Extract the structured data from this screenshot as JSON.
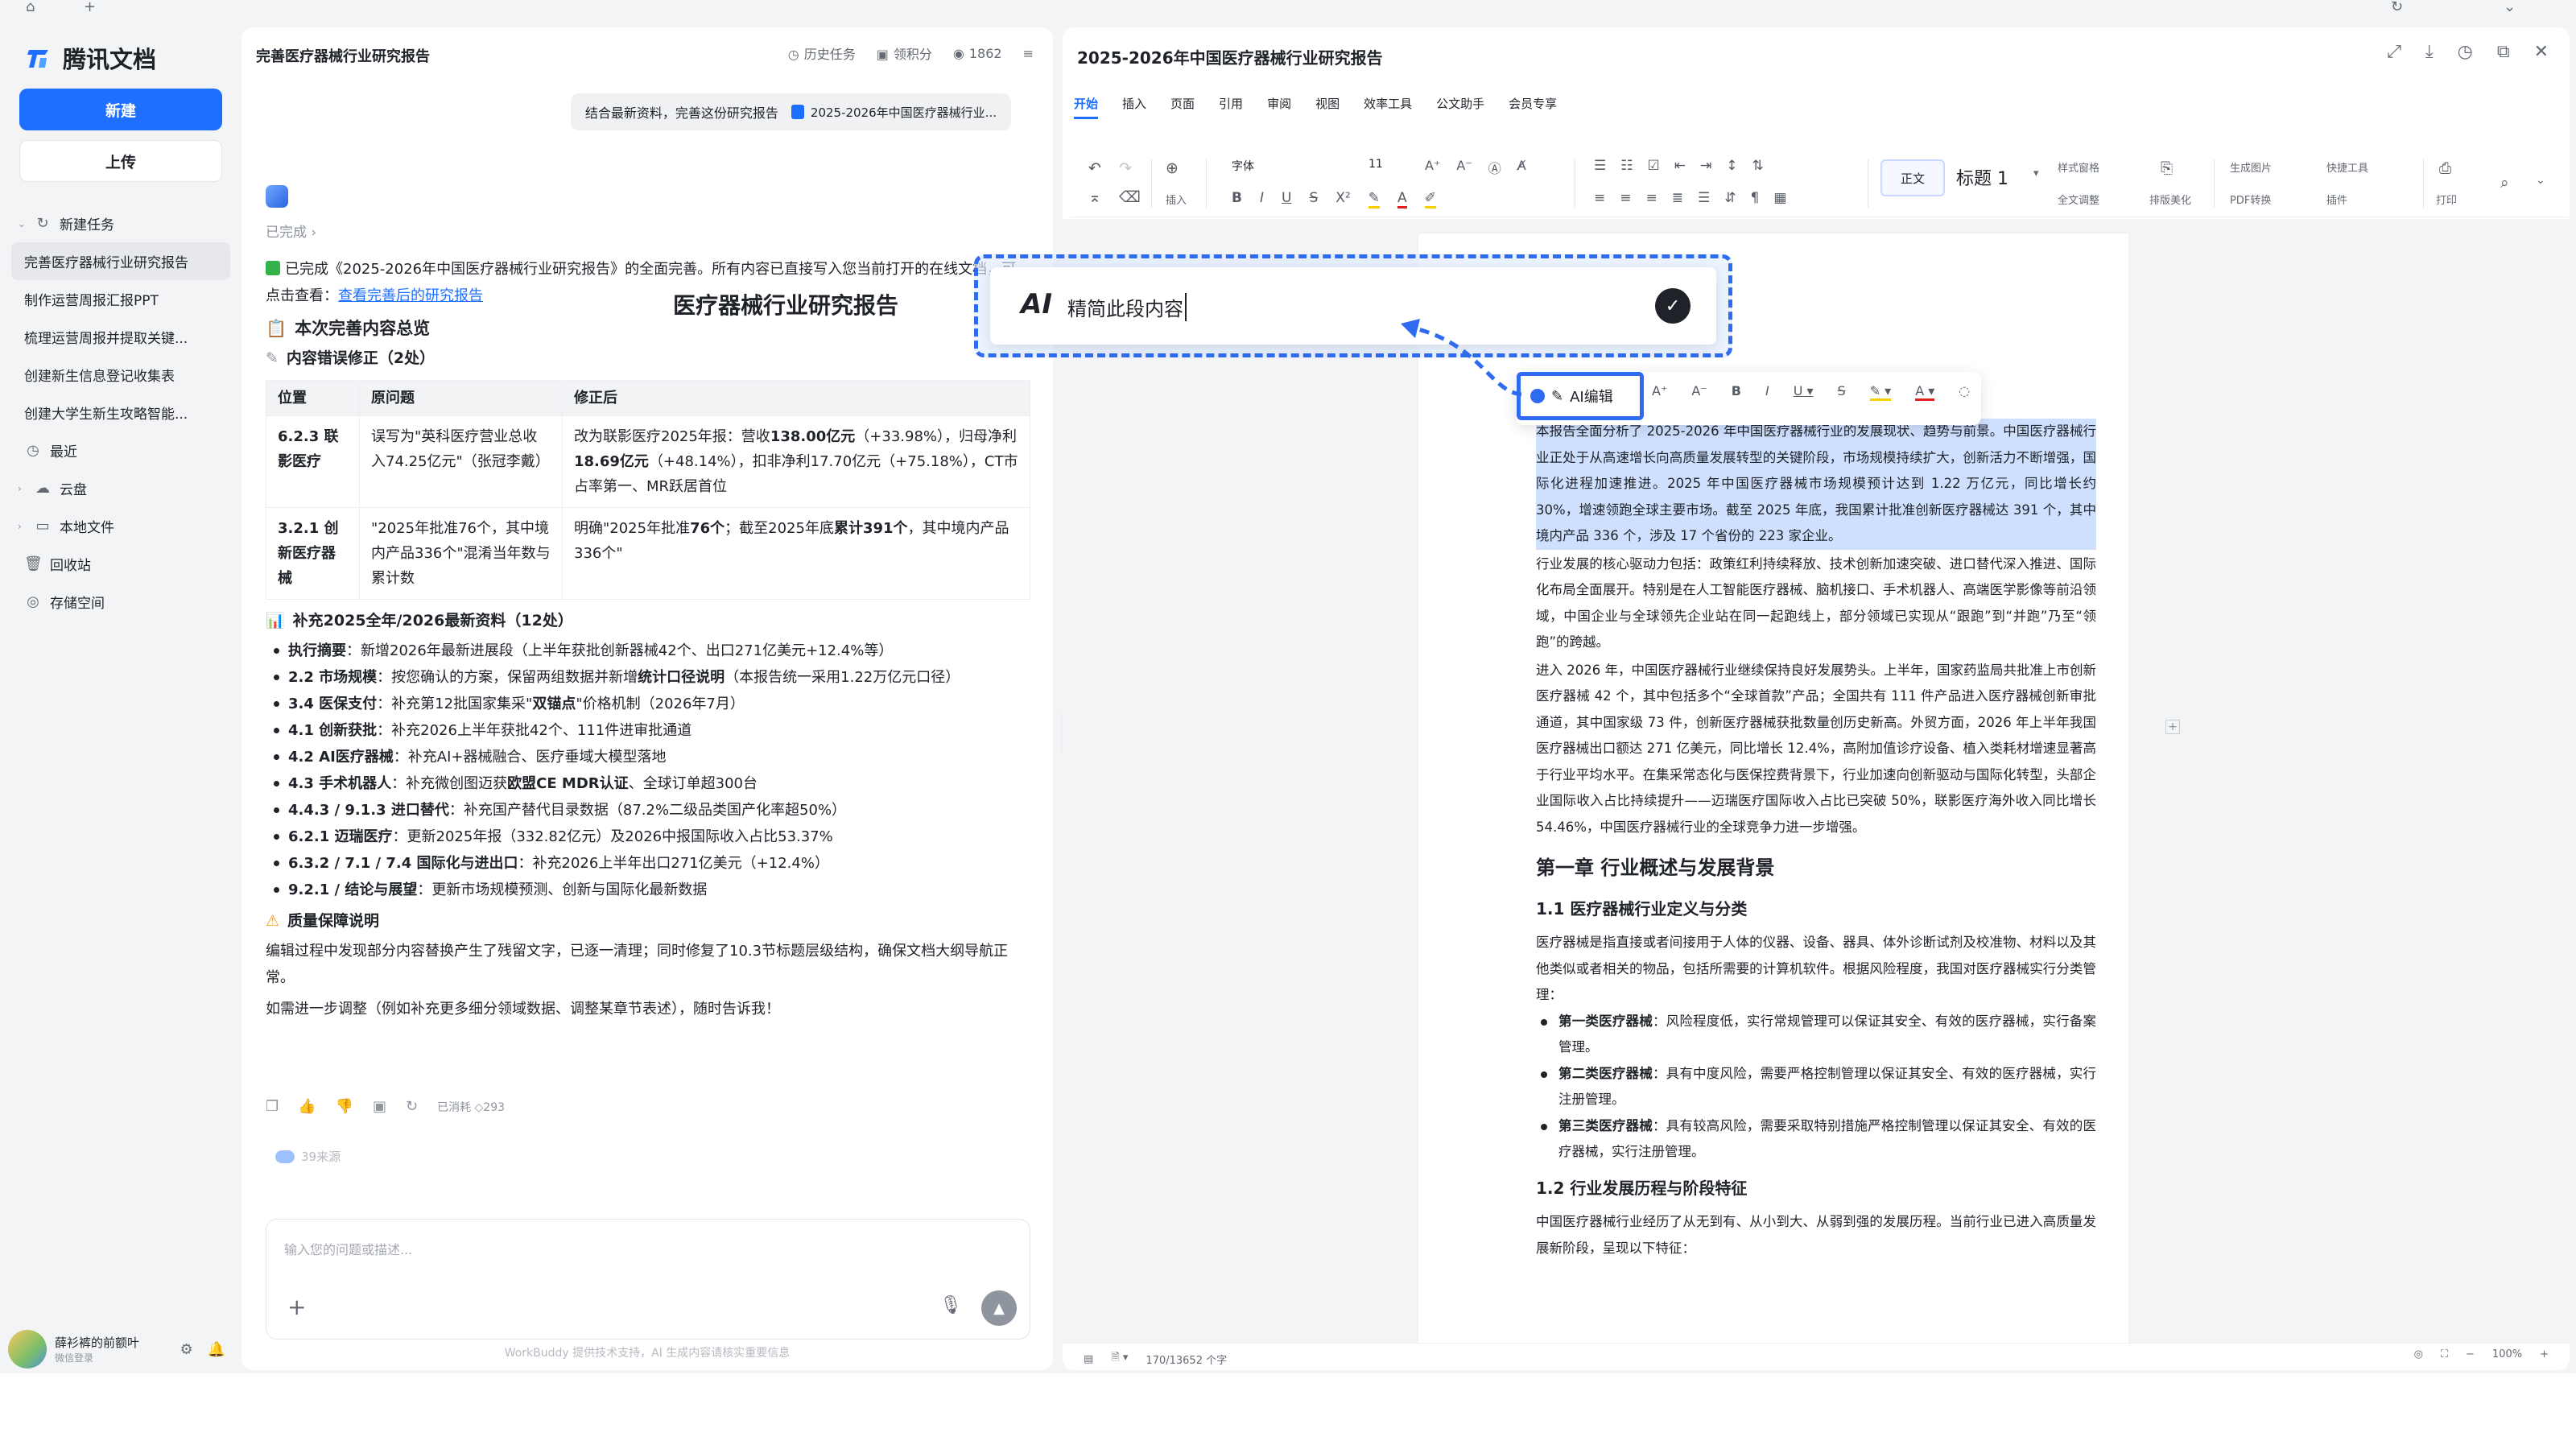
{
  "app": {
    "name": "腾讯文档"
  },
  "sidebar": {
    "new_label": "新建",
    "upload_label": "上传",
    "items": [
      {
        "label": "新建任务",
        "icon": "refresh-icon"
      },
      {
        "label": "完善医疗器械行业研究报告",
        "selected": true
      },
      {
        "label": "制作运营周报汇报PPT"
      },
      {
        "label": "梳理运营周报并提取关键..."
      },
      {
        "label": "创建新生信息登记收集表"
      },
      {
        "label": "创建大学生新生攻略智能..."
      },
      {
        "label": "最近",
        "icon": "clock-icon"
      },
      {
        "label": "云盘",
        "icon": "cloud-icon"
      },
      {
        "label": "本地文件",
        "icon": "folder-icon"
      },
      {
        "label": "回收站",
        "icon": "trash-icon"
      },
      {
        "label": "存储空间",
        "icon": "storage-icon"
      }
    ],
    "user": {
      "name": "薛衫裤的前额叶",
      "subtitle": "微信登录"
    }
  },
  "chat": {
    "title": "完善医疗器械行业研究报告",
    "actions": {
      "history": "历史任务",
      "points": "领积分",
      "count": "1862"
    },
    "user_message": "结合最新资料，完善这份研究报告",
    "attachment": "2025-2026年中国医疗器械行业...",
    "status": "已完成",
    "intro_a": "已完成《2025-2026年中国医疗器械行业研究报告》的全面完善。所有内容已直接写入您当前打开的在线文档，可点击查看：",
    "intro_link": "查看完善后的研究报告",
    "summary_heading": "本次完善内容总览",
    "fix_heading": "内容错误修正（2处）",
    "table": {
      "headers": [
        "位置",
        "原问题",
        "修正后"
      ],
      "rows": [
        {
          "pos": "6.2.3 联影医疗",
          "old": "误写为\"英科医疗营业总收入74.25亿元\"（张冠李戴）",
          "new_a": "改为联影医疗2025年报：营收",
          "new_b1": "138.00亿元",
          "new_c": "（+33.98%），归母净利",
          "new_b2": "18.69亿元",
          "new_d": "（+48.14%），扣非净利17.70亿元（+75.18%），CT市占率第一、MR跃居首位"
        },
        {
          "pos": "3.2.1 创新医疗器械",
          "old": "\"2025年批准76个，其中境内产品336个\"混淆当年数与累计数",
          "new_a": "明确\"2025年批准",
          "new_b1": "76个",
          "new_c": "；截至2025年底",
          "new_b2": "累计391个",
          "new_d": "，其中境内产品336个\""
        }
      ]
    },
    "supplement_heading": "补充2025全年/2026最新资料（12处）",
    "bullets": [
      {
        "k": "执行摘要",
        "v": "：新增2026年最新进展段（上半年获批创新器械42个、出口271亿美元+12.4%等）"
      },
      {
        "k": "2.2 市场规模",
        "v": "：按您确认的方案，保留两组数据并新增",
        "k2": "统计口径说明",
        "v2": "（本报告统一采用1.22万亿元口径）"
      },
      {
        "k": "3.4 医保支付",
        "v": "：补充第12批国家集采\"",
        "k2": "双锚点",
        "v2": "\"价格机制（2026年7月）"
      },
      {
        "k": "4.1 创新获批",
        "v": "：补充2026上半年获批42个、111件进审批通道"
      },
      {
        "k": "4.2 AI医疗器械",
        "v": "：补充AI+器械融合、医疗垂域大模型落地"
      },
      {
        "k": "4.3 手术机器人",
        "v": "：补充微创图迈获",
        "k2": "欧盟CE MDR认证",
        "v2": "、全球订单超300台"
      },
      {
        "k": "4.4.3 / 9.1.3 进口替代",
        "v": "：补充国产替代目录数据（87.2%二级品类国产化率超50%）"
      },
      {
        "k": "6.2.1 迈瑞医疗",
        "v": "：更新2025年报（332.82亿元）及2026中报国际收入占比53.37%"
      },
      {
        "k": "6.3.2 / 7.1 / 7.4 国际化与进出口",
        "v": "：补充2026上半年出口271亿美元（+12.4%）"
      },
      {
        "k": "9.2.1 / 结论与展望",
        "v": "：更新市场规模预测、创新与国际化最新数据"
      }
    ],
    "quality_heading": "质量保障说明",
    "quality_text": "编辑过程中发现部分内容替换产生了残留文字，已逐一清理；同时修复了10.3节标题层级结构，确保文档大纲导航正常。",
    "followup": "如需进一步调整（例如补充更多细分领域数据、调整某章节表述），随时告诉我！",
    "cost": "已消耗 ◇293",
    "sources": "39来源",
    "input_placeholder": "输入您的问题或描述...",
    "disclaimer": "WorkBuddy 提供技术支持，AI 生成内容请核实重要信息"
  },
  "doc": {
    "title": "2025-2026年中国医疗器械行业研究报告",
    "tabs": [
      "开始",
      "插入",
      "页面",
      "引用",
      "审阅",
      "视图",
      "效率工具",
      "公文助手",
      "会员专享"
    ],
    "ribbon": {
      "font": "字体",
      "size": "11",
      "style_normal": "正文",
      "style_h1": "标题 1",
      "insert": "插入",
      "style_sheet": "样式窗格",
      "full_adjust": "全文调整",
      "layout": "排版美化",
      "gen_image": "生成图片",
      "pdf": "PDF转换",
      "quick_tools": "快捷工具",
      "plugin": "插件",
      "print": "打印"
    },
    "heading_title": "医疗器械行业研究报告",
    "para1": "本报告全面分析了 2025-2026 年中国医疗器械行业的发展现状、趋势与前景。中国医疗器械行业正处于从高速增长向高质量发展转型的关键阶段，市场规模持续扩大，创新活力不断增强，国际化进程加速推进。2025 年中国医疗器械市场规模预计达到 1.22 万亿元，同比增长约 30%，增速领跑全球主要市场。截至 2025 年底，我国累计批准创新医疗器械达 391 个，其中境内产品 336 个，涉及 17 个省份的 223 家企业。",
    "para2": "行业发展的核心驱动力包括：政策红利持续释放、技术创新加速突破、进口替代深入推进、国际化布局全面展开。特别是在人工智能医疗器械、脑机接口、手术机器人、高端医学影像等前沿领域，中国企业与全球领先企业站在同一起跑线上，部分领域已实现从“跟跑”到“并跑”乃至“领跑”的跨越。",
    "para3": "进入 2026 年，中国医疗器械行业继续保持良好发展势头。上半年，国家药监局共批准上市创新医疗器械 42 个，其中包括多个“全球首款”产品；全国共有 111 件产品进入医疗器械创新审批通道，其中国家级 73 件，创新医疗器械获批数量创历史新高。外贸方面，2026 年上半年我国医疗器械出口额达 271 亿美元，同比增长 12.4%，高附加值诊疗设备、植入类耗材增速显著高于行业平均水平。在集采常态化与医保控费背景下，行业加速向创新驱动与国际化转型，头部企业国际收入占比持续提升——迈瑞医疗国际收入占比已突破 50%，联影医疗海外收入同比增长 54.46%，中国医疗器械行业的全球竞争力进一步增强。",
    "ch1": "第一章  行业概述与发展背景",
    "s11": "1.1  医疗器械行业定义与分类",
    "para4": "医疗器械是指直接或者间接用于人体的仪器、设备、器具、体外诊断试剂及校准物、材料以及其他类似或者相关的物品，包括所需要的计算机软件。根据风险程度，我国对医疗器械实行分类管理：",
    "classes": [
      {
        "k": "第一类医疗器械",
        "v": "：风险程度低，实行常规管理可以保证其安全、有效的医疗器械，实行备案管理。"
      },
      {
        "k": "第二类医疗器械",
        "v": "：具有中度风险，需要严格控制管理以保证其安全、有效的医疗器械，实行注册管理。"
      },
      {
        "k": "第三类医疗器械",
        "v": "：具有较高风险，需要采取特别措施严格控制管理以保证其安全、有效的医疗器械，实行注册管理。"
      }
    ],
    "s12": "1.2  行业发展历程与阶段特征",
    "para5": "中国医疗器械行业经历了从无到有、从小到大、从弱到强的发展历程。当前行业已进入高质量发展新阶段，呈现以下特征：",
    "word_count": "170/13652 个字",
    "zoom": "100%"
  },
  "float_toolbar": {
    "ai_edit": "AI编辑"
  },
  "ai_prompt": {
    "label": "AI",
    "value": "精简此段内容"
  },
  "colors": {
    "accent": "#1e6fff",
    "highlight": "#cfe0ff"
  }
}
